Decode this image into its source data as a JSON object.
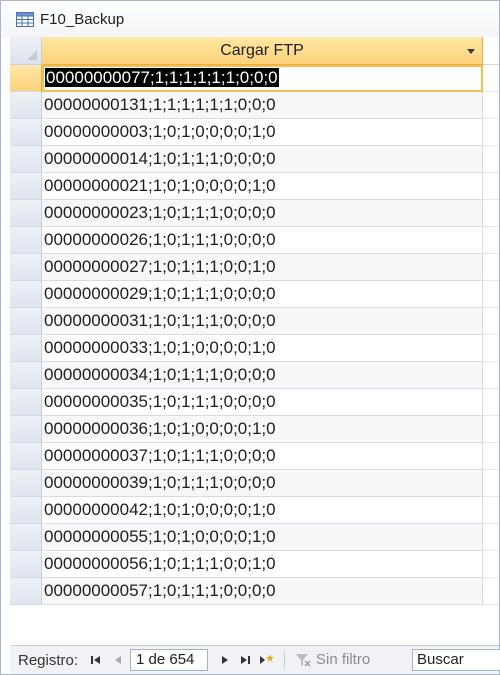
{
  "window": {
    "title": "F10_Backup",
    "icon": "datasheet-icon"
  },
  "grid": {
    "column_header": "Cargar FTP",
    "rows": [
      "00000000077;1;1;1;1;1;1;0;0;0",
      "00000000131;1;1;1;1;1;1;0;0;0",
      "00000000003;1;0;1;0;0;0;0;1;0",
      "00000000014;1;0;1;1;1;0;0;0;0",
      "00000000021;1;0;1;0;0;0;0;1;0",
      "00000000023;1;0;1;1;1;0;0;0;0",
      "00000000026;1;0;1;1;1;0;0;0;0",
      "00000000027;1;0;1;1;1;0;0;1;0",
      "00000000029;1;0;1;1;1;0;0;0;0",
      "00000000031;1;0;1;1;1;0;0;0;0",
      "00000000033;1;0;1;0;0;0;0;1;0",
      "00000000034;1;0;1;1;1;0;0;0;0",
      "00000000035;1;0;1;1;1;0;0;0;0",
      "00000000036;1;0;1;0;0;0;0;1;0",
      "00000000037;1;0;1;1;1;0;0;0;0",
      "00000000039;1;0;1;1;1;0;0;0;0",
      "00000000042;1;0;1;0;0;0;0;1;0",
      "00000000055;1;0;1;0;0;0;0;1;0",
      "00000000056;1;0;1;1;1;0;0;1;0",
      "00000000057;1;0;1;1;1;0;0;0;0"
    ]
  },
  "navigation": {
    "label": "Registro:",
    "current_record": "1 de 654",
    "filter_label": "Sin filtro",
    "search_value": "Buscar"
  },
  "colors": {
    "header_accent": "#fdd27b",
    "selection": "#000000"
  }
}
